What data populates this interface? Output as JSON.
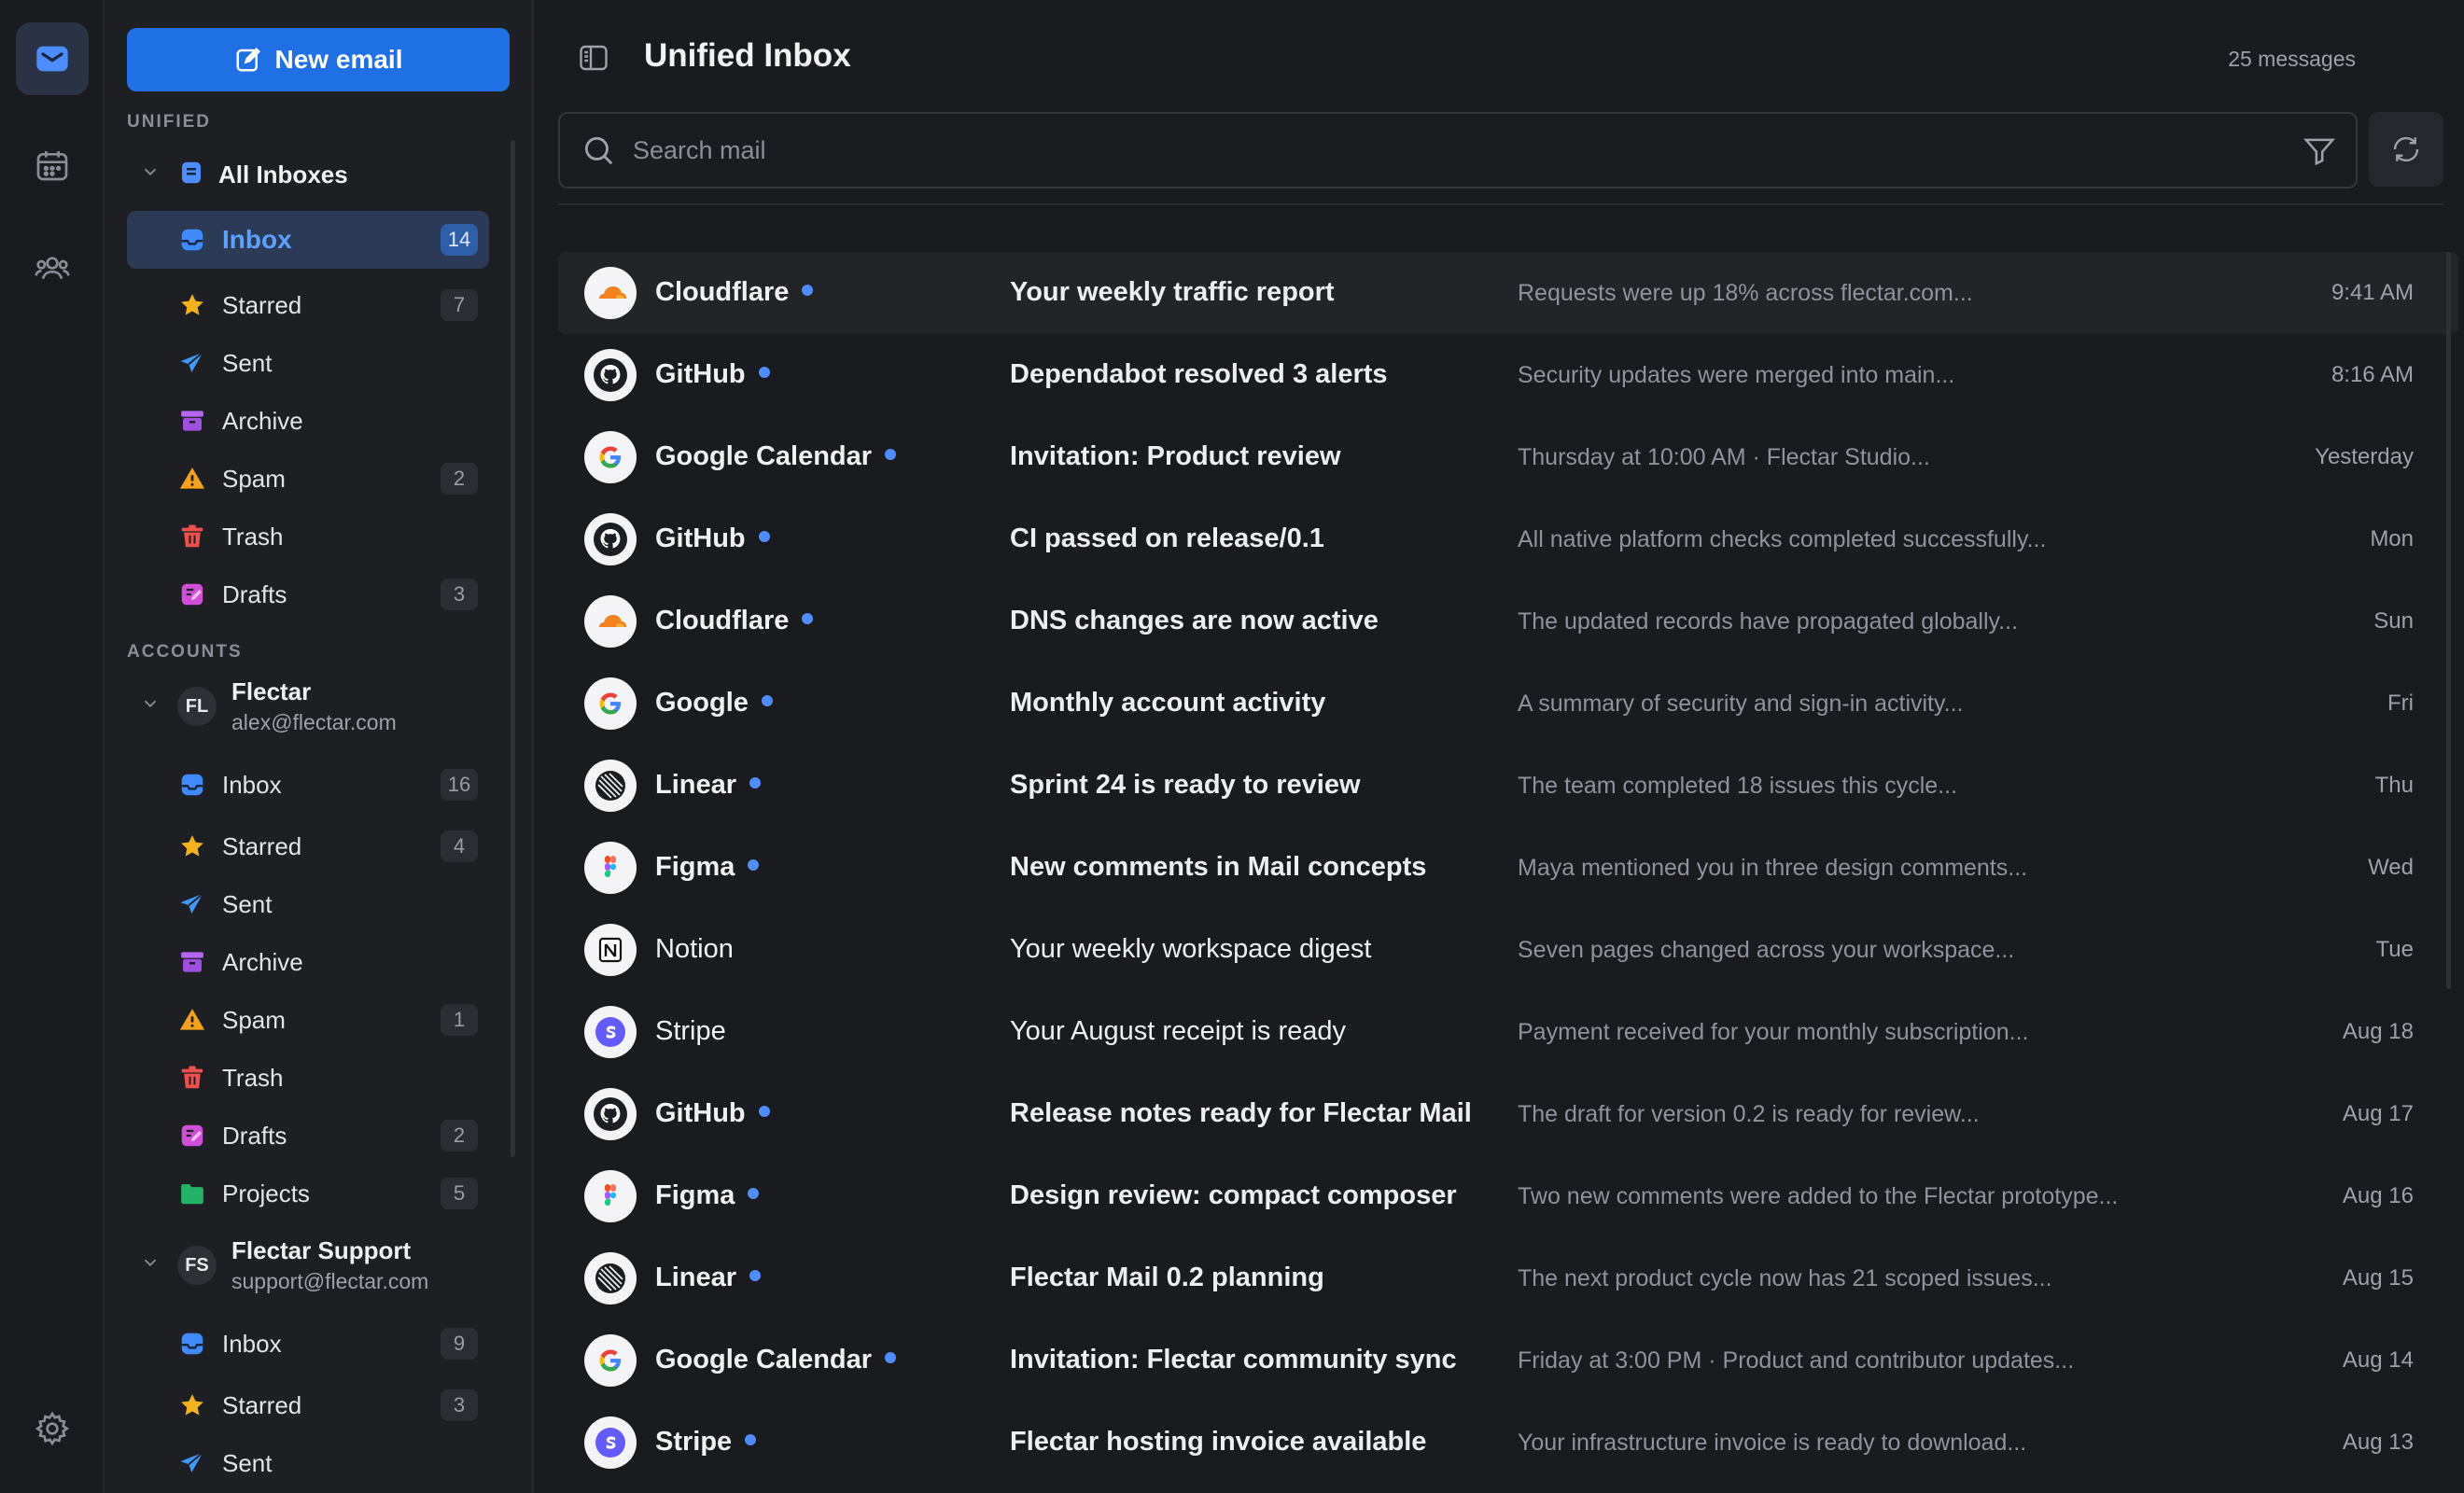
{
  "colors": {
    "accent": "#1f6fe5",
    "unread_dot": "#4c8dff",
    "active_folder": "#2b3a55"
  },
  "rail": {
    "items": [
      "mail-icon",
      "calendar-icon",
      "contacts-icon",
      "settings-icon"
    ]
  },
  "sidebar": {
    "new_email": "New email",
    "unified_label": "UNIFIED",
    "all_inboxes": "All Inboxes",
    "unified_folders": [
      {
        "label": "Inbox",
        "count": "14",
        "icon": "inbox"
      },
      {
        "label": "Starred",
        "count": "7",
        "icon": "star"
      },
      {
        "label": "Sent",
        "count": "",
        "icon": "sent"
      },
      {
        "label": "Archive",
        "count": "",
        "icon": "archive"
      },
      {
        "label": "Spam",
        "count": "2",
        "icon": "spam"
      },
      {
        "label": "Trash",
        "count": "",
        "icon": "trash"
      },
      {
        "label": "Drafts",
        "count": "3",
        "icon": "drafts"
      }
    ],
    "accounts_label": "ACCOUNTS",
    "accounts": [
      {
        "initials": "FL",
        "name": "Flectar",
        "email": "alex@flectar.com",
        "folders": [
          {
            "label": "Inbox",
            "count": "16"
          },
          {
            "label": "Starred",
            "count": "4"
          },
          {
            "label": "Sent",
            "count": ""
          },
          {
            "label": "Archive",
            "count": ""
          },
          {
            "label": "Spam",
            "count": "1"
          },
          {
            "label": "Trash",
            "count": ""
          },
          {
            "label": "Drafts",
            "count": "2"
          },
          {
            "label": "Projects",
            "count": "5"
          }
        ]
      },
      {
        "initials": "FS",
        "name": "Flectar Support",
        "email": "support@flectar.com",
        "folders": [
          {
            "label": "Inbox",
            "count": "9"
          },
          {
            "label": "Starred",
            "count": "3"
          },
          {
            "label": "Sent",
            "count": ""
          }
        ]
      }
    ]
  },
  "main": {
    "title": "Unified Inbox",
    "message_count": "25 messages",
    "search_placeholder": "Search mail",
    "messages": [
      {
        "sender": "Cloudflare",
        "logo": "cloudflare",
        "unread": true,
        "subject": "Your weekly traffic report",
        "preview": "Requests were up 18% across flectar.com...",
        "time": "9:41 AM"
      },
      {
        "sender": "GitHub",
        "logo": "github",
        "unread": true,
        "subject": "Dependabot resolved 3 alerts",
        "preview": "Security updates were merged into main...",
        "time": "8:16 AM"
      },
      {
        "sender": "Google Calendar",
        "logo": "google",
        "unread": true,
        "subject": "Invitation: Product review",
        "preview": "Thursday at 10:00 AM · Flectar Studio...",
        "time": "Yesterday"
      },
      {
        "sender": "GitHub",
        "logo": "github",
        "unread": true,
        "subject": "CI passed on release/0.1",
        "preview": "All native platform checks completed successfully...",
        "time": "Mon"
      },
      {
        "sender": "Cloudflare",
        "logo": "cloudflare",
        "unread": true,
        "subject": "DNS changes are now active",
        "preview": "The updated records have propagated globally...",
        "time": "Sun"
      },
      {
        "sender": "Google",
        "logo": "google",
        "unread": true,
        "subject": "Monthly account activity",
        "preview": "A summary of security and sign-in activity...",
        "time": "Fri"
      },
      {
        "sender": "Linear",
        "logo": "linear",
        "unread": true,
        "subject": "Sprint 24 is ready to review",
        "preview": "The team completed 18 issues this cycle...",
        "time": "Thu"
      },
      {
        "sender": "Figma",
        "logo": "figma",
        "unread": true,
        "subject": "New comments in Mail concepts",
        "preview": "Maya mentioned you in three design comments...",
        "time": "Wed"
      },
      {
        "sender": "Notion",
        "logo": "notion",
        "unread": false,
        "subject": "Your weekly workspace digest",
        "preview": "Seven pages changed across your workspace...",
        "time": "Tue"
      },
      {
        "sender": "Stripe",
        "logo": "stripe",
        "unread": false,
        "subject": "Your August receipt is ready",
        "preview": "Payment received for your monthly subscription...",
        "time": "Aug 18"
      },
      {
        "sender": "GitHub",
        "logo": "github",
        "unread": true,
        "subject": "Release notes ready for Flectar Mail",
        "preview": "The draft for version 0.2 is ready for review...",
        "time": "Aug 17"
      },
      {
        "sender": "Figma",
        "logo": "figma",
        "unread": true,
        "subject": "Design review: compact composer",
        "preview": "Two new comments were added to the Flectar prototype...",
        "time": "Aug 16"
      },
      {
        "sender": "Linear",
        "logo": "linear",
        "unread": true,
        "subject": "Flectar Mail 0.2 planning",
        "preview": "The next product cycle now has 21 scoped issues...",
        "time": "Aug 15"
      },
      {
        "sender": "Google Calendar",
        "logo": "google",
        "unread": true,
        "subject": "Invitation: Flectar community sync",
        "preview": "Friday at 3:00 PM · Product and contributor updates...",
        "time": "Aug 14"
      },
      {
        "sender": "Stripe",
        "logo": "stripe",
        "unread": true,
        "subject": "Flectar hosting invoice available",
        "preview": "Your infrastructure invoice is ready to download...",
        "time": "Aug 13"
      }
    ]
  }
}
